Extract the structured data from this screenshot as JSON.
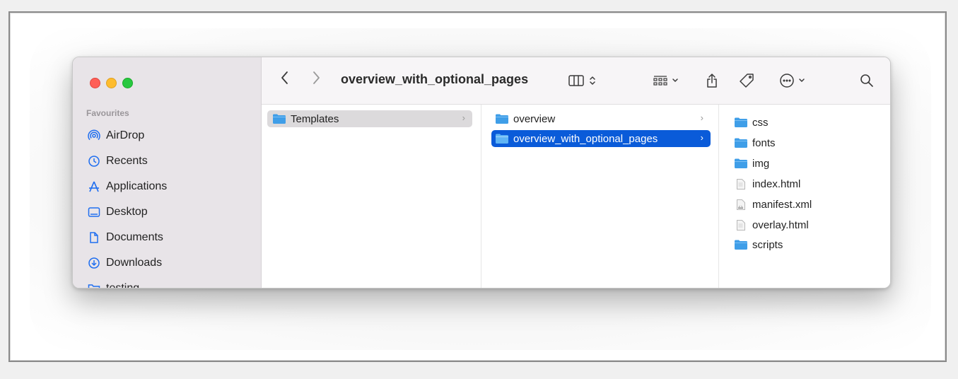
{
  "window": {
    "title": "overview_with_optional_pages"
  },
  "sidebar": {
    "heading": "Favourites",
    "items": [
      {
        "label": "AirDrop",
        "icon": "airdrop-icon"
      },
      {
        "label": "Recents",
        "icon": "clock-icon"
      },
      {
        "label": "Applications",
        "icon": "applications-icon"
      },
      {
        "label": "Desktop",
        "icon": "desktop-icon"
      },
      {
        "label": "Documents",
        "icon": "document-icon"
      },
      {
        "label": "Downloads",
        "icon": "download-icon"
      },
      {
        "label": "testing",
        "icon": "folder-icon"
      }
    ]
  },
  "toolbar": {
    "back": "‹",
    "forward": "›",
    "view_mode_icon": "columns-view-icon",
    "group_icon": "group-grid-icon",
    "share_icon": "share-icon",
    "tag_icon": "tag-icon",
    "more_icon": "ellipsis-circle-icon",
    "search_icon": "search-icon"
  },
  "columns": [
    {
      "items": [
        {
          "name": "Templates",
          "type": "folder",
          "has_children": true,
          "state": "selected-inactive"
        }
      ]
    },
    {
      "items": [
        {
          "name": "overview",
          "type": "folder",
          "has_children": true,
          "state": "normal"
        },
        {
          "name": "overview_with_optional_pages",
          "type": "folder",
          "has_children": true,
          "state": "selected-active"
        }
      ]
    },
    {
      "items": [
        {
          "name": "css",
          "type": "folder"
        },
        {
          "name": "fonts",
          "type": "folder"
        },
        {
          "name": "img",
          "type": "folder"
        },
        {
          "name": "index.html",
          "type": "file"
        },
        {
          "name": "manifest.xml",
          "type": "file"
        },
        {
          "name": "overlay.html",
          "type": "file"
        },
        {
          "name": "scripts",
          "type": "folder"
        }
      ]
    }
  ],
  "colors": {
    "selection_active": "#0a5bd9",
    "selection_inactive": "#dcdadc",
    "folder": "#3f9ee8",
    "sidebar_icon": "#1f6ef0"
  }
}
